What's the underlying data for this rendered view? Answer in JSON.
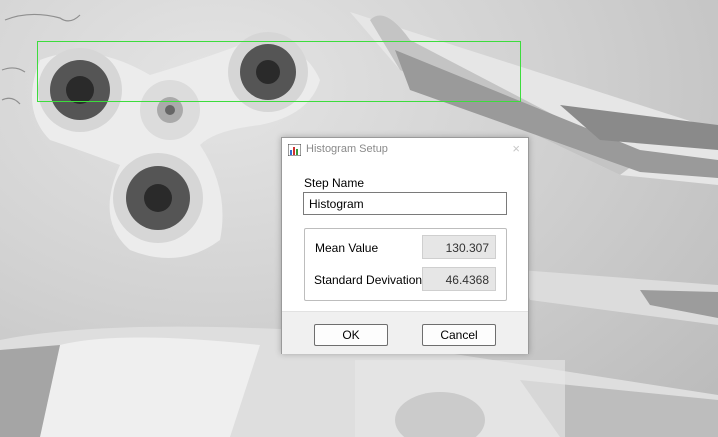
{
  "dialog": {
    "title": "Histogram Setup",
    "close_glyph": "×",
    "icon": "histogram-app-icon",
    "step_name_label": "Step Name",
    "step_name_value": "Histogram",
    "mean_label": "Mean Value",
    "mean_value": "130.307",
    "std_label": "Standard Devivation",
    "std_value": "46.4368",
    "ok_label": "OK",
    "cancel_label": "Cancel"
  },
  "colors": {
    "roi_outline": "#3ddc3d",
    "readonly_bg": "#e6e6e6",
    "footer_bg": "#f0f0f0"
  }
}
